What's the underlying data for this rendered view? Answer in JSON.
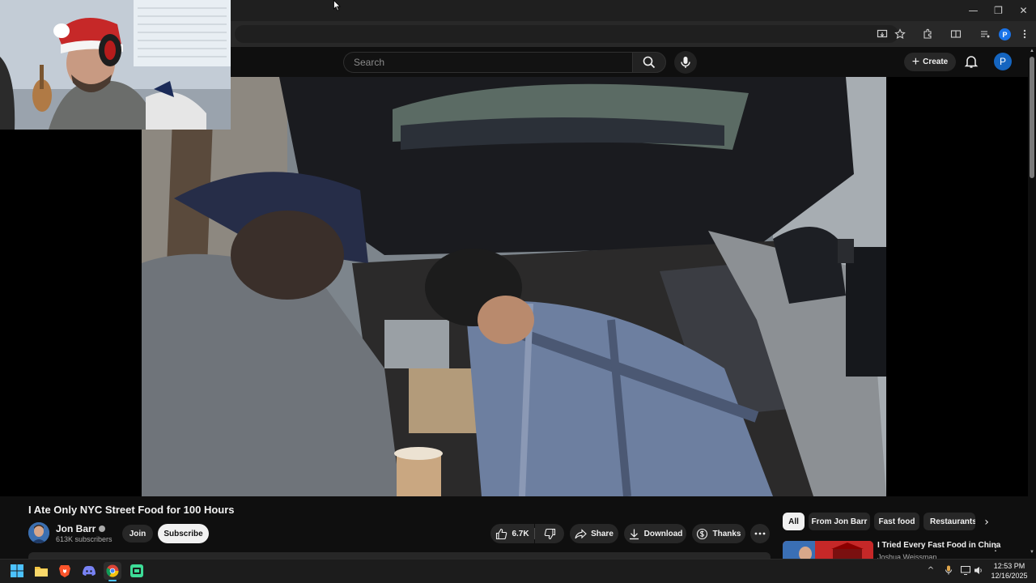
{
  "browser": {
    "window_controls": {
      "minimize": "—",
      "restore": "❐",
      "close": "✕"
    },
    "profile_initial": "P"
  },
  "header": {
    "search_placeholder": "Search",
    "create_label": "Create",
    "avatar_initial": "P"
  },
  "video": {
    "title": "I Ate Only NYC Street Food for 100 Hours",
    "channel_name": "Jon Barr",
    "subscribers": "613K subscribers",
    "join_label": "Join",
    "subscribe_label": "Subscribe",
    "likes": "6.7K",
    "share_label": "Share",
    "download_label": "Download",
    "thanks_label": "Thanks"
  },
  "chips": [
    "All",
    "From Jon Barr",
    "Fast food",
    "Restaurants"
  ],
  "recommended": [
    {
      "title": "I Tried Every Fast Food in China",
      "channel": "Joshua Weissman"
    }
  ],
  "taskbar": {
    "apps": [
      "start-icon",
      "file-explorer-icon",
      "brave-icon",
      "discord-icon",
      "chrome-icon",
      "app-icon"
    ],
    "time": "12:53 PM",
    "date": "12/16/2025"
  },
  "colors": {
    "background": "#0f0f0f",
    "pill": "#272727",
    "subscribe_bg": "#f1f1f1",
    "avatar_blue": "#1565c0"
  }
}
